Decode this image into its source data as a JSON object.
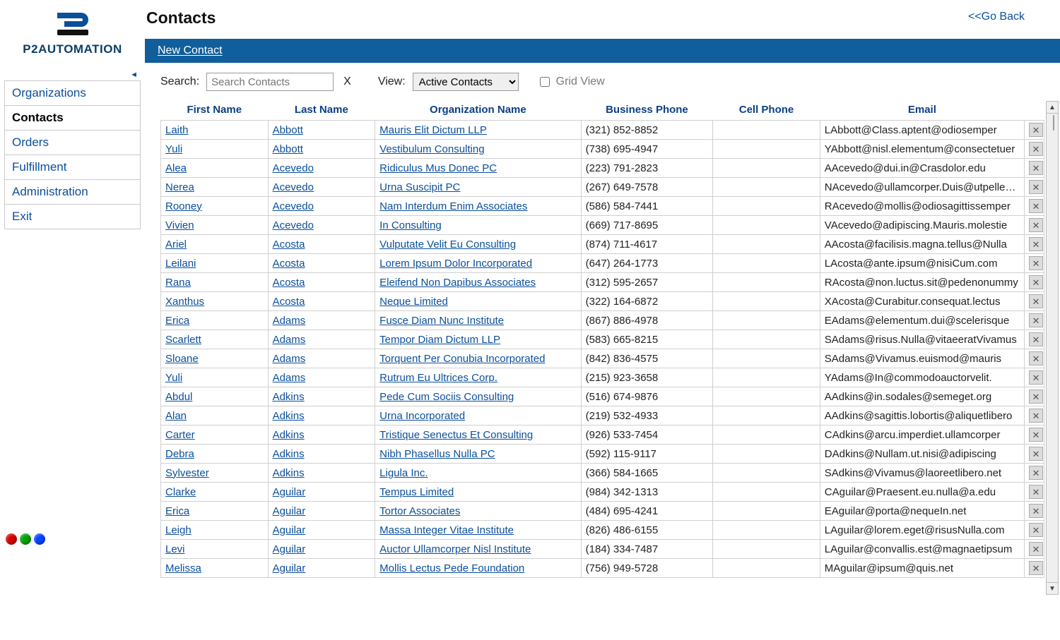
{
  "brand": {
    "line1": "P2",
    "line2": "AUTOMATION"
  },
  "page_title": "Contacts",
  "go_back": "<<Go Back",
  "action_bar": {
    "new_contact": "New Contact"
  },
  "filters": {
    "search_label": "Search:",
    "search_placeholder": "Search Contacts",
    "clear": "X",
    "view_label": "View:",
    "view_value": "Active Contacts",
    "gridview_label": "Grid View"
  },
  "sidenav": {
    "items": [
      {
        "label": "Organizations",
        "active": false
      },
      {
        "label": "Contacts",
        "active": true
      },
      {
        "label": "Orders",
        "active": false
      },
      {
        "label": "Fulfillment",
        "active": false
      },
      {
        "label": "Administration",
        "active": false
      },
      {
        "label": "Exit",
        "active": false
      }
    ]
  },
  "columns": {
    "first": "First Name",
    "last": "Last Name",
    "org": "Organization Name",
    "bphone": "Business Phone",
    "cphone": "Cell Phone",
    "email": "Email"
  },
  "rows": [
    {
      "first": "Laith",
      "last": "Abbott",
      "org": "Mauris Elit Dictum LLP",
      "bphone": "(321) 852-8852",
      "cphone": "",
      "email": "LAbbott@Class.aptent@odiosemper"
    },
    {
      "first": "Yuli",
      "last": "Abbott",
      "org": "Vestibulum Consulting",
      "bphone": "(738) 695-4947",
      "cphone": "",
      "email": "YAbbott@nisl.elementum@consectetuer"
    },
    {
      "first": "Alea",
      "last": "Acevedo",
      "org": "Ridiculus Mus Donec PC",
      "bphone": "(223) 791-2823",
      "cphone": "",
      "email": "AAcevedo@dui.in@Crasdolor.edu"
    },
    {
      "first": "Nerea",
      "last": "Acevedo",
      "org": "Urna Suscipit PC",
      "bphone": "(267) 649-7578",
      "cphone": "",
      "email": "NAcevedo@ullamcorper.Duis@utpellentesque"
    },
    {
      "first": "Rooney",
      "last": "Acevedo",
      "org": "Nam Interdum Enim Associates",
      "bphone": "(586) 584-7441",
      "cphone": "",
      "email": "RAcevedo@mollis@odiosagittissemper"
    },
    {
      "first": "Vivien",
      "last": "Acevedo",
      "org": "In Consulting",
      "bphone": "(669) 717-8695",
      "cphone": "",
      "email": "VAcevedo@adipiscing.Mauris.molestie"
    },
    {
      "first": "Ariel",
      "last": "Acosta",
      "org": "Vulputate Velit Eu Consulting",
      "bphone": "(874) 711-4617",
      "cphone": "",
      "email": "AAcosta@facilisis.magna.tellus@Nulla"
    },
    {
      "first": "Leilani",
      "last": "Acosta",
      "org": "Lorem Ipsum Dolor Incorporated",
      "bphone": "(647) 264-1773",
      "cphone": "",
      "email": "LAcosta@ante.ipsum@nisiCum.com"
    },
    {
      "first": "Rana",
      "last": "Acosta",
      "org": "Eleifend Non Dapibus Associates",
      "bphone": "(312) 595-2657",
      "cphone": "",
      "email": "RAcosta@non.luctus.sit@pedenonummy"
    },
    {
      "first": "Xanthus",
      "last": "Acosta",
      "org": "Neque Limited",
      "bphone": "(322) 164-6872",
      "cphone": "",
      "email": "XAcosta@Curabitur.consequat.lectus"
    },
    {
      "first": "Erica",
      "last": "Adams",
      "org": "Fusce Diam Nunc Institute",
      "bphone": "(867) 886-4978",
      "cphone": "",
      "email": "EAdams@elementum.dui@scelerisque"
    },
    {
      "first": "Scarlett",
      "last": "Adams",
      "org": "Tempor Diam Dictum LLP",
      "bphone": "(583) 665-8215",
      "cphone": "",
      "email": "SAdams@risus.Nulla@vitaeeratVivamus"
    },
    {
      "first": "Sloane",
      "last": "Adams",
      "org": "Torquent Per Conubia Incorporated",
      "bphone": "(842) 836-4575",
      "cphone": "",
      "email": "SAdams@Vivamus.euismod@mauris"
    },
    {
      "first": "Yuli",
      "last": "Adams",
      "org": "Rutrum Eu Ultrices Corp.",
      "bphone": "(215) 923-3658",
      "cphone": "",
      "email": "YAdams@In@commodoauctorvelit."
    },
    {
      "first": "Abdul",
      "last": "Adkins",
      "org": "Pede Cum Sociis Consulting",
      "bphone": "(516) 674-9876",
      "cphone": "",
      "email": "AAdkins@in.sodales@semeget.org"
    },
    {
      "first": "Alan",
      "last": "Adkins",
      "org": "Urna Incorporated",
      "bphone": "(219) 532-4933",
      "cphone": "",
      "email": "AAdkins@sagittis.lobortis@aliquetlibero"
    },
    {
      "first": "Carter",
      "last": "Adkins",
      "org": "Tristique Senectus Et Consulting",
      "bphone": "(926) 533-7454",
      "cphone": "",
      "email": "CAdkins@arcu.imperdiet.ullamcorper"
    },
    {
      "first": "Debra",
      "last": "Adkins",
      "org": "Nibh Phasellus Nulla PC",
      "bphone": "(592) 115-9117",
      "cphone": "",
      "email": "DAdkins@Nullam.ut.nisi@adipiscing"
    },
    {
      "first": "Sylvester",
      "last": "Adkins",
      "org": "Ligula Inc.",
      "bphone": "(366) 584-1665",
      "cphone": "",
      "email": "SAdkins@Vivamus@laoreetlibero.net"
    },
    {
      "first": "Clarke",
      "last": "Aguilar",
      "org": "Tempus Limited",
      "bphone": "(984) 342-1313",
      "cphone": "",
      "email": "CAguilar@Praesent.eu.nulla@a.edu"
    },
    {
      "first": "Erica",
      "last": "Aguilar",
      "org": "Tortor Associates",
      "bphone": "(484) 695-4241",
      "cphone": "",
      "email": "EAguilar@porta@nequeIn.net"
    },
    {
      "first": "Leigh",
      "last": "Aguilar",
      "org": "Massa Integer Vitae Institute",
      "bphone": "(826) 486-6155",
      "cphone": "",
      "email": "LAguilar@lorem.eget@risusNulla.com"
    },
    {
      "first": "Levi",
      "last": "Aguilar",
      "org": "Auctor Ullamcorper Nisl Institute",
      "bphone": "(184) 334-7487",
      "cphone": "",
      "email": "LAguilar@convallis.est@magnaetipsum"
    },
    {
      "first": "Melissa",
      "last": "Aguilar",
      "org": "Mollis Lectus Pede Foundation",
      "bphone": "(756) 949-5728",
      "cphone": "",
      "email": "MAguilar@ipsum@quis.net"
    }
  ]
}
